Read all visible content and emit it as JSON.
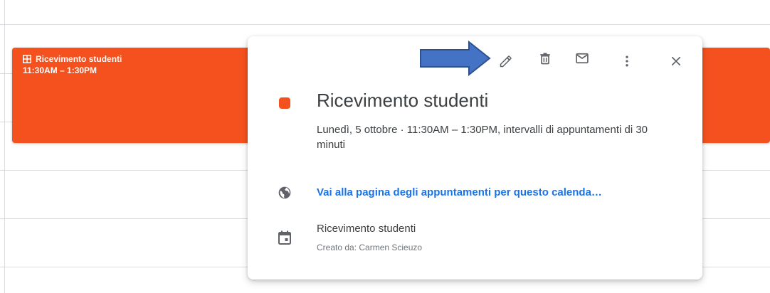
{
  "event_block": {
    "title": "Ricevimento studenti",
    "time": "11:30AM – 1:30PM",
    "color": "#f4511e",
    "icon": "appointment-grid-icon"
  },
  "popup": {
    "toolbar": {
      "edit_icon": "pencil-icon",
      "delete_icon": "trash-icon",
      "email_icon": "envelope-icon",
      "more_icon": "more-vert-icon",
      "close_icon": "close-icon"
    },
    "title": "Ricevimento studenti",
    "color": "#f4511e",
    "when": "Lunedì, 5 ottobre  ·  11:30AM – 1:30PM, intervalli di appuntamenti di 30 minuti",
    "booking_link": {
      "icon": "globe-icon",
      "label": "Vai alla pagina degli appuntamenti per questo calenda…",
      "color": "#1a73e8"
    },
    "calendar": {
      "icon": "calendar-icon",
      "name": "Ricevimento studenti",
      "created_by": "Creato da: Carmen Scieuzo"
    }
  },
  "annotation": {
    "type": "arrow",
    "color": "#4472c4",
    "points_to": "pencil-icon"
  }
}
